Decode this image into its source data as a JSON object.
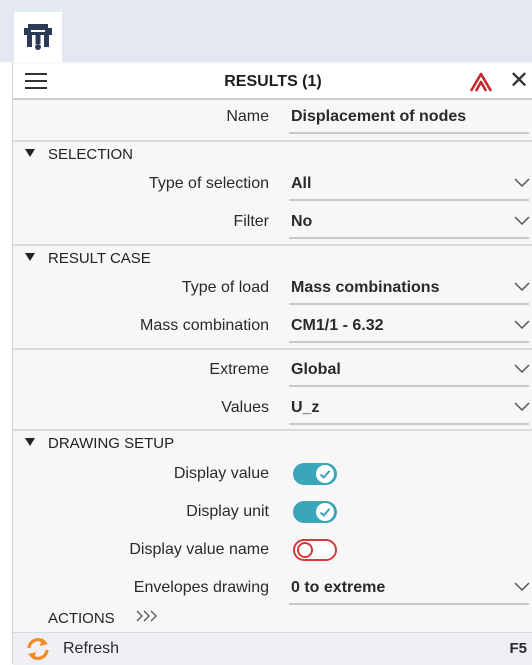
{
  "panel": {
    "title": "RESULTS (1)",
    "name_label": "Name",
    "name_value": "Displacement of nodes"
  },
  "selection": {
    "title": "SELECTION",
    "type_label": "Type of selection",
    "type_value": "All",
    "filter_label": "Filter",
    "filter_value": "No"
  },
  "result_case": {
    "title": "RESULT CASE",
    "load_label": "Type of load",
    "load_value": "Mass combinations",
    "mass_label": "Mass combination",
    "mass_value": "CM1/1 - 6.32",
    "extreme_label": "Extreme",
    "extreme_value": "Global",
    "values_label": "Values",
    "values_value": "U_z"
  },
  "drawing": {
    "title": "DRAWING SETUP",
    "display_value_label": "Display value",
    "display_value_on": true,
    "display_unit_label": "Display unit",
    "display_unit_on": true,
    "display_value_name_label": "Display value name",
    "display_value_name_on": false,
    "envelopes_label": "Envelopes drawing",
    "envelopes_value": "0 to extreme"
  },
  "actions": {
    "title": "ACTIONS",
    "refresh_label": "Refresh",
    "refresh_shortcut": "F5"
  },
  "colors": {
    "toggle_on": "#3aa6b9",
    "toggle_off": "#d33a3a",
    "refresh_icon": "#f28c28",
    "pin_icon": "#c0282d"
  },
  "icons": [
    "app-logo-icon",
    "hamburger-menu-icon",
    "pin-icon",
    "close-icon",
    "chevron-down-icon",
    "collapse-triangle-icon",
    "check-icon",
    "double-chevron-right-icon",
    "refresh-icon"
  ]
}
